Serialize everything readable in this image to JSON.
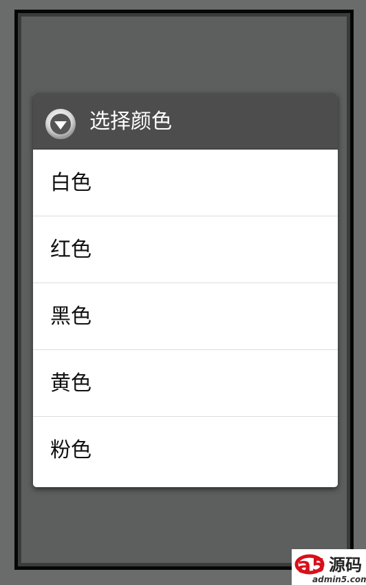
{
  "dialog": {
    "title": "选择颜色",
    "options": [
      {
        "label": "白色"
      },
      {
        "label": "红色"
      },
      {
        "label": "黑色"
      },
      {
        "label": "黄色"
      },
      {
        "label": "粉色"
      }
    ]
  },
  "watermark": {
    "logo_text": "源码",
    "site_text": "admin5.com",
    "brand_color": "#d8101a"
  },
  "colors": {
    "title_bar": "#4d4d4d",
    "background": "#6a6b6b",
    "screen": "#5d5e5e"
  },
  "icons": {
    "title_icon": "dropdown-circle-icon"
  }
}
